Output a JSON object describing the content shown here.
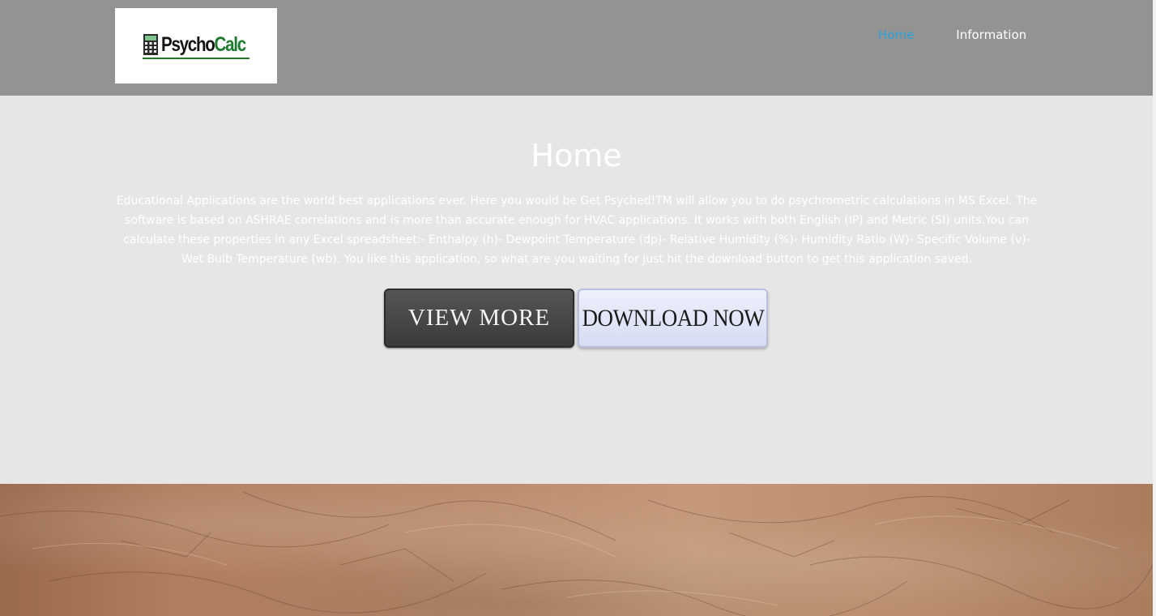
{
  "brand": {
    "logo_text_part1": "Psycho",
    "logo_text_part2": "Calc",
    "logo_icon": "calculator-icon"
  },
  "nav": {
    "items": [
      {
        "label": "Home",
        "active": true
      },
      {
        "label": "Information",
        "active": false
      }
    ]
  },
  "hero": {
    "title": "Home",
    "body": "Educational Applications are the world best applications ever. Here you would be Get Psyched!TM will allow you to do psychrometric calculations in MS Excel. The software is based on ASHRAE correlations and is more than accurate enough for HVAC applications. It works with both English (IP) and Metric (SI) units.You can calculate these properties in any Excel spreadsheet:- Enthalpy (h)- Dewpoint Temperature (dp)- Relative Humidity (%)- Humidity Ratio (W)- Specific Volume (v)- Wet Bulb Temperature (wb). You like this application, so what are you waiting for just hit the download button to get this application saved.",
    "buttons": {
      "view_more": "VIEW MORE",
      "download_now": "DOWNLOAD NOW"
    }
  },
  "colors": {
    "header_bg": "#939393",
    "hero_bg": "#e6e6e6",
    "nav_active": "#2aa4d8",
    "logo_green": "#1e7a2e",
    "texture_base": "#b98a6a"
  }
}
